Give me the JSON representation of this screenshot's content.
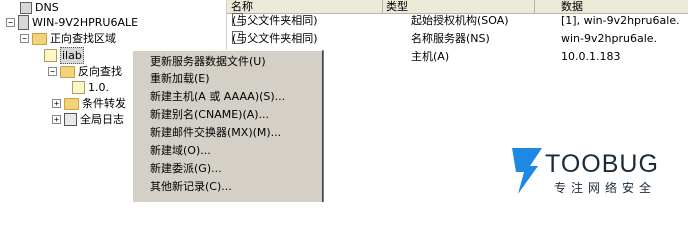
{
  "tree": {
    "root": "DNS",
    "server": "WIN-9V2HPRU6ALE",
    "forward": "正向查找区域",
    "forward_selected": "ilab",
    "reverse": "反向查找",
    "reverse_child": "1.0.",
    "conditional": "条件转发",
    "global_logs": "全局日志"
  },
  "list": {
    "headers": [
      "名称",
      "类型",
      "数据"
    ],
    "rows": [
      [
        "(与父文件夹相同)",
        "起始授权机构(SOA)",
        "[1], win-9v2hpru6ale."
      ],
      [
        "(与父文件夹相同)",
        "名称服务器(NS)",
        "win-9v2hpru6ale."
      ],
      [
        "",
        "主机(A)",
        "10.0.1.183"
      ]
    ]
  },
  "context_menu": {
    "items": [
      "更新服务器数据文件(U)",
      "重新加载(E)",
      "新建主机(A 或 AAAA)(S)...",
      "新建别名(CNAME)(A)...",
      "新建邮件交换器(MX)(M)...",
      "新建域(O)...",
      "新建委派(G)...",
      "其他新记录(C)..."
    ]
  },
  "watermark": {
    "brand": "TOOBUG",
    "tagline": "专注网络安全",
    "color": "#1e88e5"
  }
}
